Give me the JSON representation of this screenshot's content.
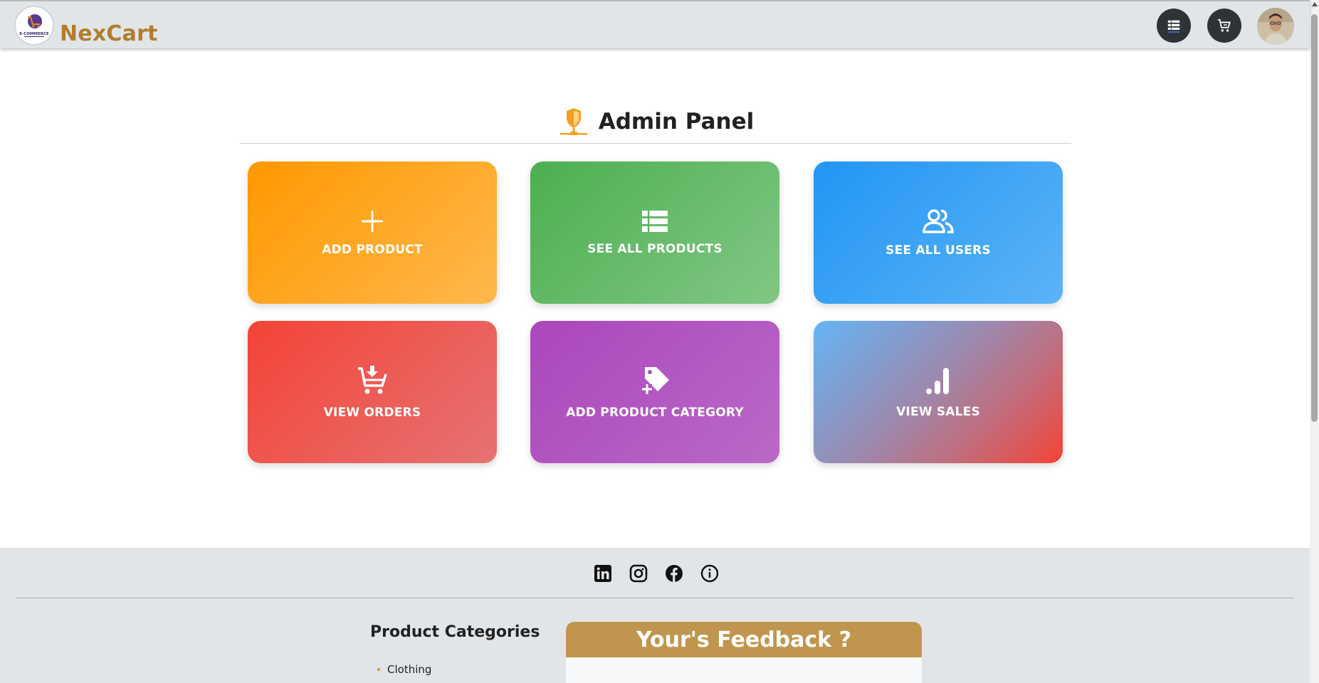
{
  "header": {
    "brand": "NexCart",
    "logo_text": "E-COMMERCE",
    "menu_icon": "list-icon",
    "cart_icon": "cart-icon",
    "avatar_icon": "user-avatar"
  },
  "main": {
    "title": "Admin Panel",
    "title_icon": "admin-shield-icon",
    "cards": [
      {
        "label": "ADD PRODUCT",
        "icon": "plus-icon",
        "color": "#ff9800"
      },
      {
        "label": "SEE ALL PRODUCTS",
        "icon": "list-icon",
        "color": "#4caf50"
      },
      {
        "label": "SEE ALL USERS",
        "icon": "users-icon",
        "color": "#2196f3"
      },
      {
        "label": "VIEW ORDERS",
        "icon": "cart-download-icon",
        "color": "#f44336"
      },
      {
        "label": "ADD PRODUCT CATEGORY",
        "icon": "tag-plus-icon",
        "color": "#ab47bc"
      },
      {
        "label": "VIEW SALES",
        "icon": "bar-chart-icon",
        "color": "#f44336"
      }
    ]
  },
  "footer": {
    "social": [
      "linkedin-icon",
      "instagram-icon",
      "facebook-icon",
      "info-icon"
    ],
    "categories_title": "Product Categories",
    "categories": [
      "Clothing"
    ],
    "feedback_title": "Your's Feedback ?"
  },
  "colors": {
    "brand": "#b07e2c",
    "header_bg": "#e2e5e8",
    "feedback_bar": "#c0964e"
  }
}
